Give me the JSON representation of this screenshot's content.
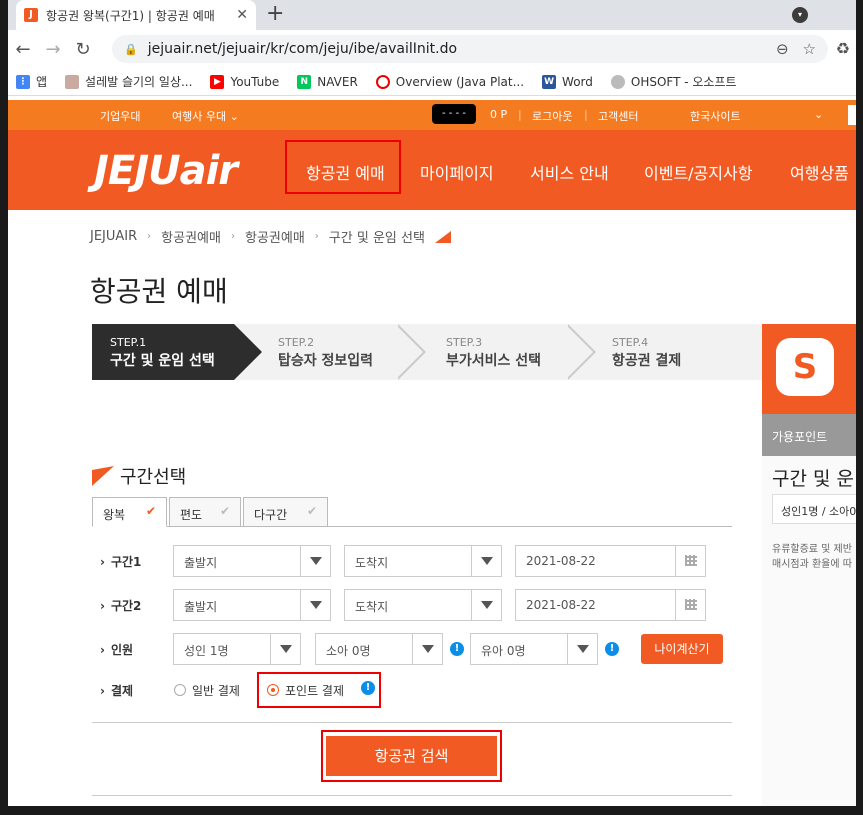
{
  "browser": {
    "tab_title": "항공권 왕복(구간1) | 항공권 예매",
    "url": "jejuair.net/jejuair/kr/com/jeju/ibe/availInit.do",
    "bookmarks": [
      {
        "label": "앱",
        "icon": "apps-grid-icon"
      },
      {
        "label": "설레발 슬기의 일상...",
        "icon": "blog-avatar-icon"
      },
      {
        "label": "YouTube",
        "icon": "youtube-icon"
      },
      {
        "label": "NAVER",
        "icon": "naver-icon"
      },
      {
        "label": "Overview (Java Plat...",
        "icon": "java-icon"
      },
      {
        "label": "Word",
        "icon": "word-icon"
      },
      {
        "label": "OHSOFT - 오소프트",
        "icon": "ohsoft-icon"
      }
    ]
  },
  "util": {
    "corp": "기업우대",
    "agency": "여행사 우대",
    "masked": "- - - -",
    "points": "0 P",
    "logout": "로그아웃",
    "support": "고객센터",
    "site": "한국사이트"
  },
  "nav": {
    "logo": "JEJUair",
    "items": [
      "항공권 예매",
      "마이페이지",
      "서비스 안내",
      "이벤트/공지사항",
      "여행상품"
    ]
  },
  "breadcrumb": [
    "JEJUAIR",
    "항공권예매",
    "항공권예매",
    "구간 및 운임 선택"
  ],
  "page_title": "항공권 예매",
  "steps": [
    {
      "num": "STEP.1",
      "label": "구간 및 운임 선택"
    },
    {
      "num": "STEP.2",
      "label": "탑승자 정보입력"
    },
    {
      "num": "STEP.3",
      "label": "부가서비스 선택"
    },
    {
      "num": "STEP.4",
      "label": "항공권 결제"
    }
  ],
  "right_panel": {
    "badge": "S",
    "points_label": "가용포인트",
    "heading": "구간 및 운",
    "pax": "성인1명 / 소아0",
    "note1": "유류할증료 및 제반",
    "note2": "매시점과 환율에 따"
  },
  "section_title": "구간선택",
  "trip_tabs": [
    "왕복",
    "편도",
    "다구간"
  ],
  "rows": {
    "seg1_label": "구간1",
    "seg2_label": "구간2",
    "pax_label": "인원",
    "pay_label": "결제",
    "depart_placeholder": "출발지",
    "arrive_placeholder": "도착지",
    "seg1_date": "2021-08-22",
    "seg2_date": "2021-08-22",
    "adult": "성인 1명",
    "child": "소아 0명",
    "infant": "유아 0명",
    "age_calc": "나이계산기",
    "pay_normal": "일반 결제",
    "pay_point": "포인트 결제"
  },
  "search_button": "항공권 검색",
  "colors": {
    "brand": "#f15a22",
    "util": "#f47b20",
    "highlight": "#ee0000"
  }
}
